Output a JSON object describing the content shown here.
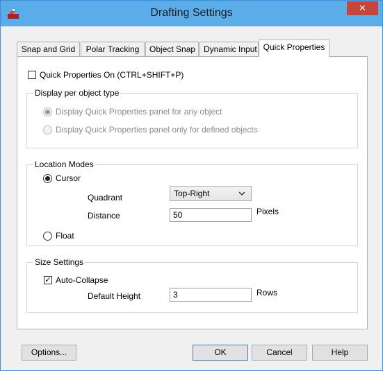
{
  "window": {
    "title": "Drafting Settings",
    "close_icon": "close-icon"
  },
  "tabs": [
    {
      "label": "Snap and Grid",
      "active": false
    },
    {
      "label": "Polar Tracking",
      "active": false
    },
    {
      "label": "Object Snap",
      "active": false
    },
    {
      "label": "Dynamic Input",
      "active": false
    },
    {
      "label": "Quick Properties",
      "active": true
    }
  ],
  "quick_properties": {
    "enable_label": "Quick Properties On (CTRL+SHIFT+P)",
    "enabled": false,
    "display_group": {
      "title": "Display per object type",
      "options": [
        {
          "label": "Display Quick Properties panel for any object",
          "selected": true
        },
        {
          "label": "Display Quick Properties panel only for defined objects",
          "selected": false
        }
      ]
    },
    "location_group": {
      "title": "Location Modes",
      "cursor_label": "Cursor",
      "cursor_selected": true,
      "quadrant_label": "Quadrant",
      "quadrant_value": "Top-Right",
      "distance_label": "Distance",
      "distance_value": "50",
      "distance_unit": "Pixels",
      "float_label": "Float",
      "float_selected": false
    },
    "size_group": {
      "title": "Size Settings",
      "auto_collapse_label": "Auto-Collapse",
      "auto_collapse_checked": true,
      "default_height_label": "Default Height",
      "default_height_value": "3",
      "default_height_unit": "Rows"
    }
  },
  "buttons": {
    "options": "Options...",
    "ok": "OK",
    "cancel": "Cancel",
    "help": "Help"
  },
  "colors": {
    "titlebar": "#5badea",
    "close": "#c7453a",
    "accent_border": "#3c7fb1"
  }
}
